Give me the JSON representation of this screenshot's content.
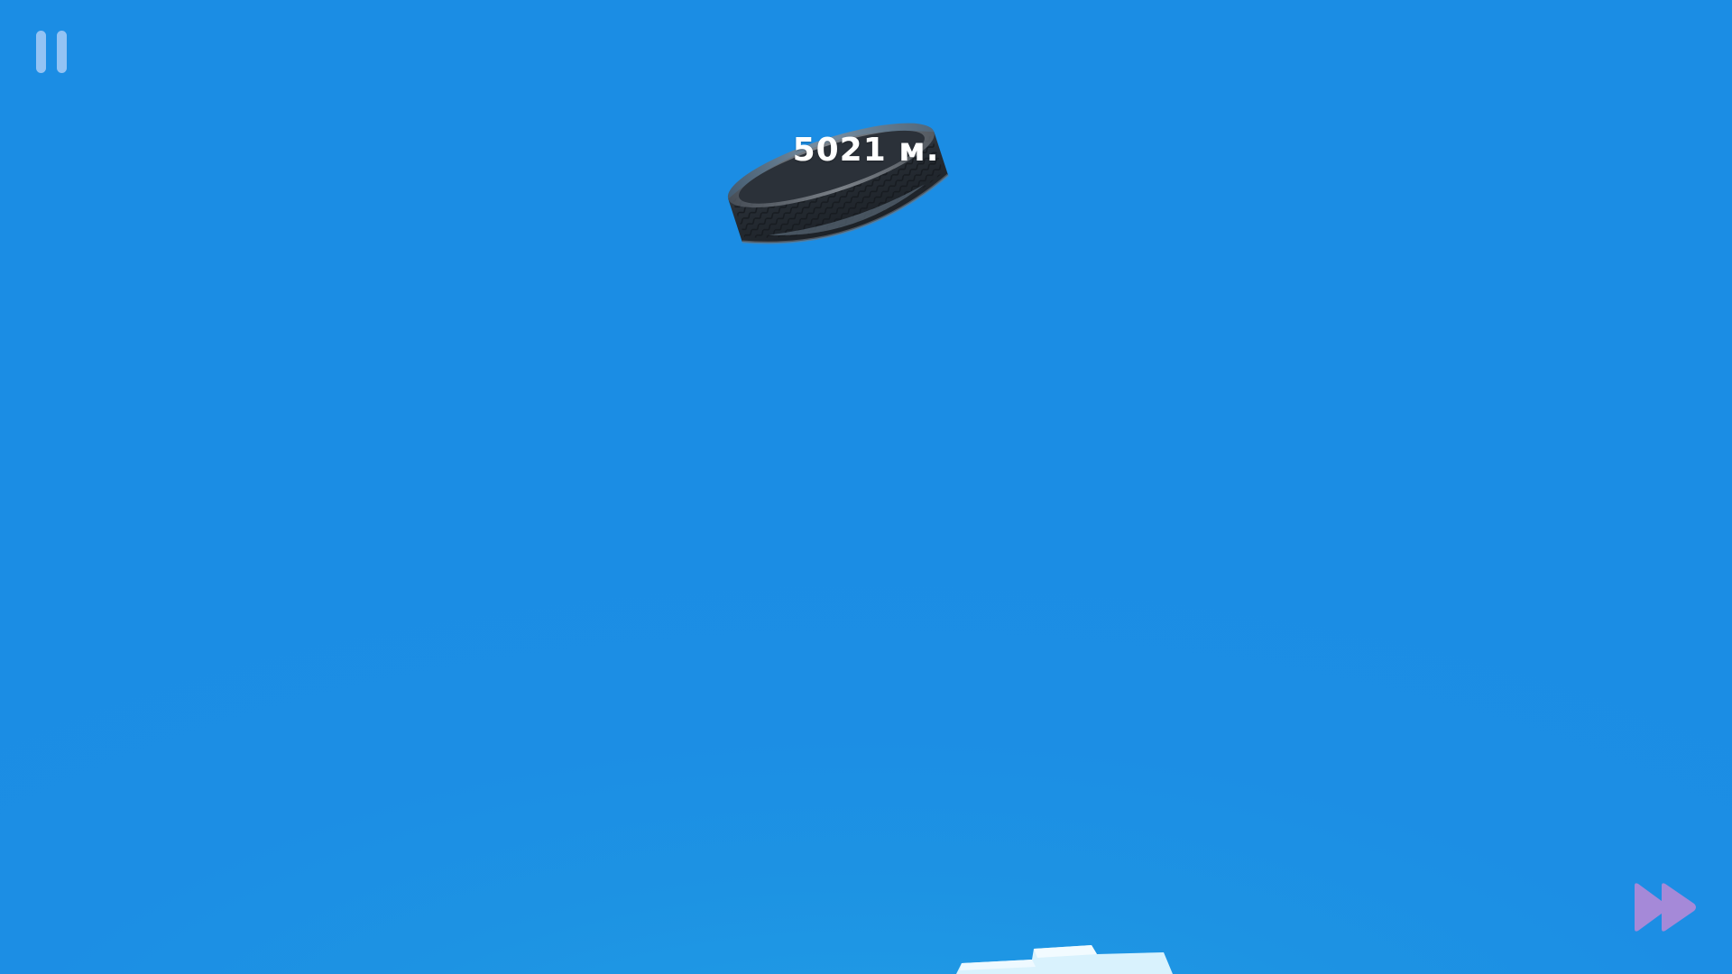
{
  "hud": {
    "pause_icon": "pause-icon",
    "fast_forward_icon": "fast-forward-icon"
  },
  "game": {
    "distance_label": "5021 м."
  },
  "colors": {
    "sky": "#1b8de4",
    "pause_button": "#93c3f4",
    "fast_forward_button": "#a589d8",
    "tire": "#2a3038"
  }
}
